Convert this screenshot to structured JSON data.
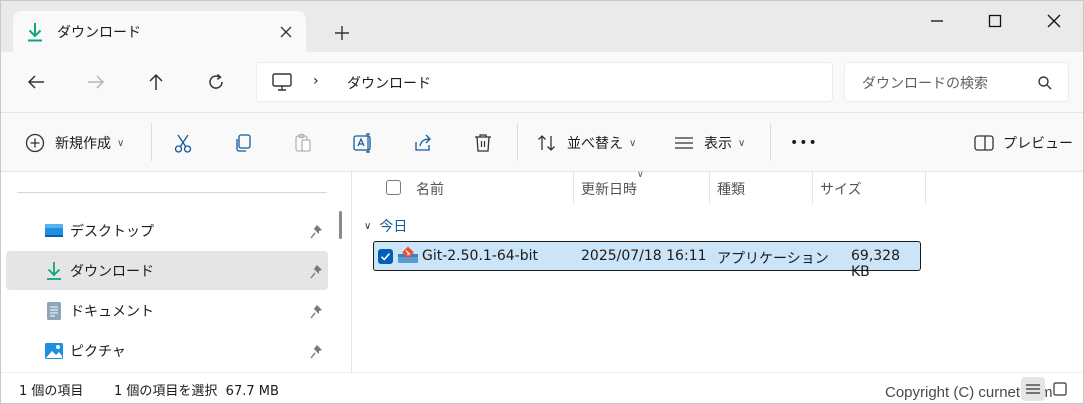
{
  "tab": {
    "title": "ダウンロード",
    "close": "✕"
  },
  "newtab": "+",
  "address": {
    "separator": "›",
    "path": "ダウンロード"
  },
  "search": {
    "placeholder": "ダウンロードの検索"
  },
  "toolbar": {
    "new_label": "新規作成",
    "sort_label": "並べ替え",
    "view_label": "表示",
    "more_label": "•••",
    "preview_label": "プレビュー"
  },
  "sidebar": {
    "items": [
      {
        "label": "デスクトップ",
        "icon": "desktop-icon"
      },
      {
        "label": "ダウンロード",
        "icon": "download-icon",
        "selected": true
      },
      {
        "label": "ドキュメント",
        "icon": "document-icon"
      },
      {
        "label": "ピクチャ",
        "icon": "pictures-icon"
      }
    ]
  },
  "columns": {
    "name": "名前",
    "modified": "更新日時",
    "type": "種類",
    "size": "サイズ"
  },
  "group": {
    "label": "今日",
    "chevron": "∨"
  },
  "files": [
    {
      "name": "Git-2.50.1-64-bit",
      "modified": "2025/07/18 16:11",
      "type": "アプリケーション",
      "size": "69,328 KB"
    }
  ],
  "status": {
    "count": "1 個の項目",
    "selection": "1 個の項目を選択  67.7 MB"
  },
  "watermark": "Copyright (C) curnet.com",
  "colors": {
    "accent": "#005fb8",
    "selected_row": "#cce4f7",
    "download_green": "#11a47f"
  }
}
